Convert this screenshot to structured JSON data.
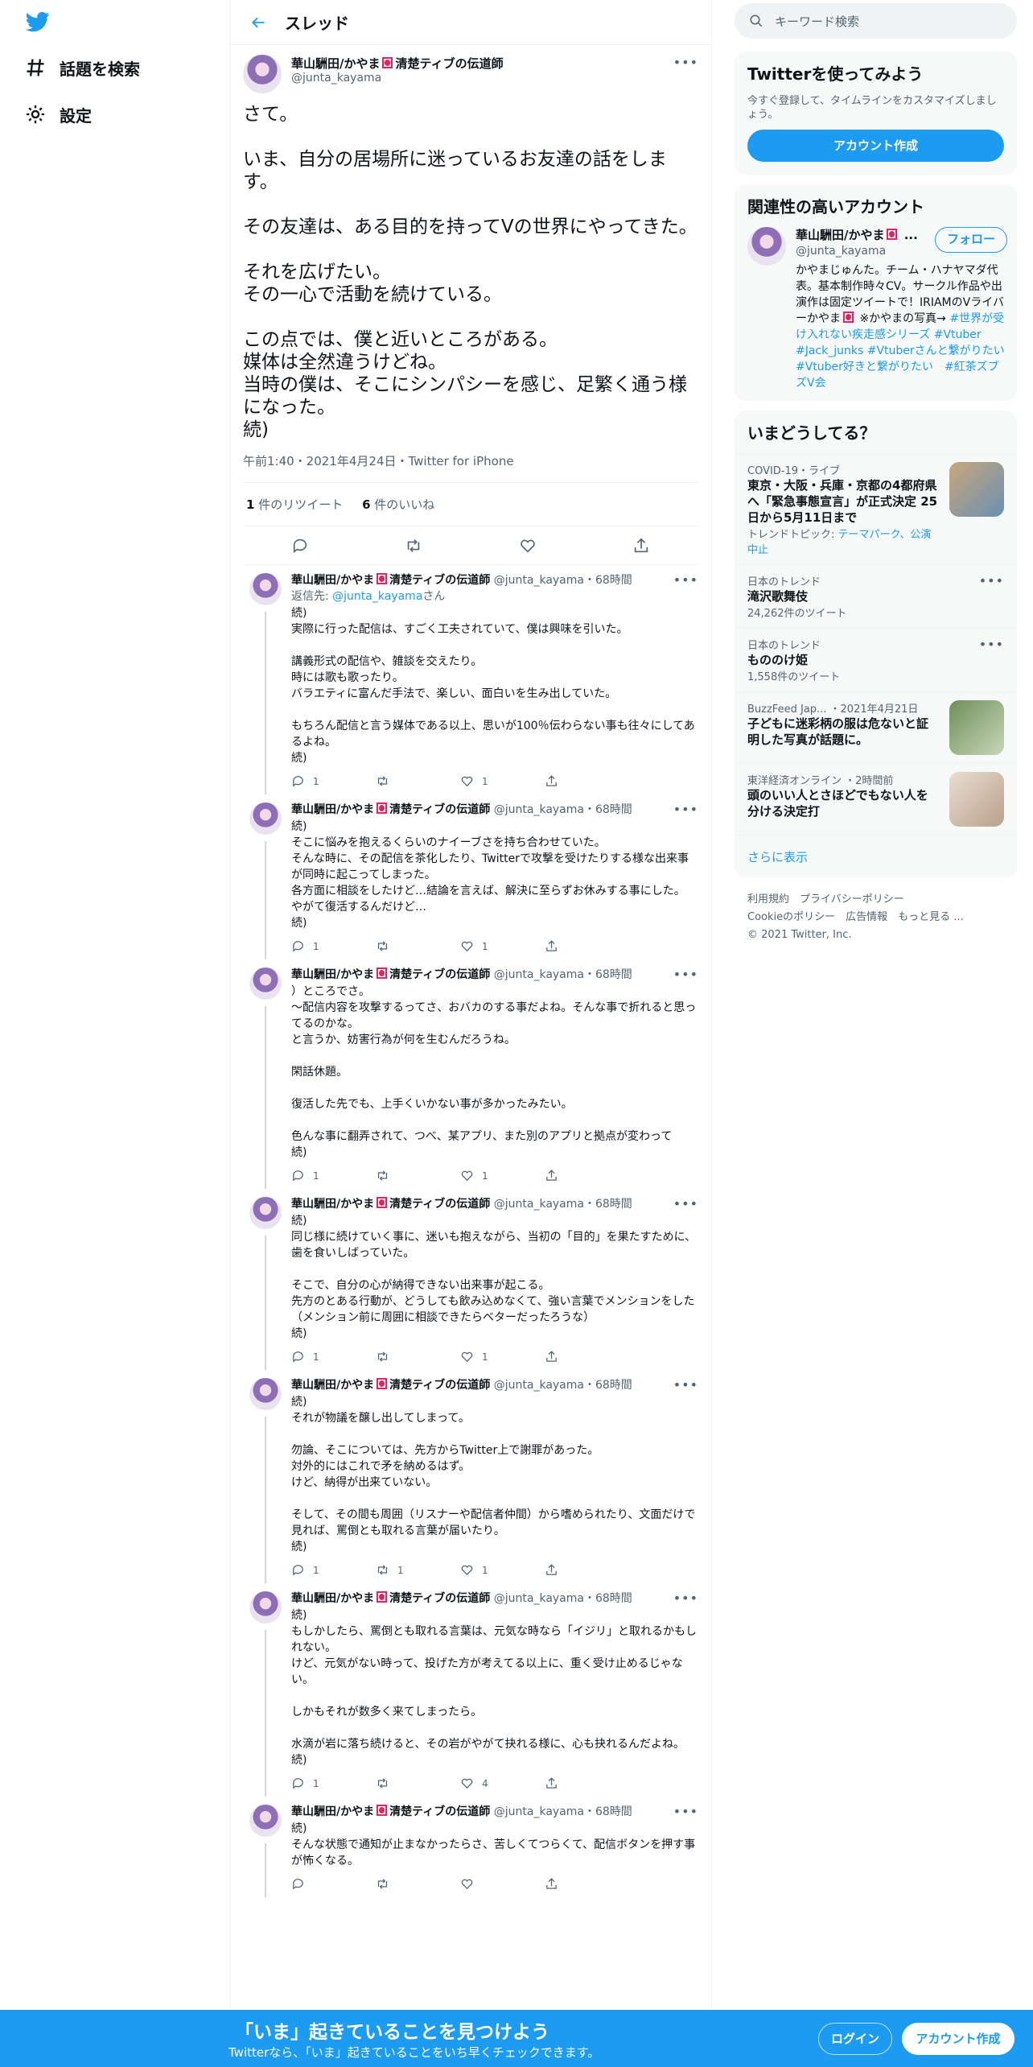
{
  "nav": {
    "explore": "話題を検索",
    "settings": "設定"
  },
  "header": {
    "title": "スレッド"
  },
  "author": {
    "name": "華山駲田/かやま",
    "name_suffix": "清楚ティブの伝道師",
    "handle": "@junta_kayama",
    "time": "68時間"
  },
  "main": {
    "text": "さて。\n\nいま、自分の居場所に迷っているお友達の話をします。\n\nその友達は、ある目的を持ってVの世界にやってきた。\n\nそれを広げたい。\nその一心で活動を続けている。\n\nこの点では、僕と近いところがある。\n媒体は全然違うけどね。\n当時の僕は、そこにシンパシーを感じ、足繁く通う様になった。\n続)",
    "meta": "午前1:40・2021年4月24日・Twitter for iPhone",
    "retweets": "1",
    "retweets_label": "件のリツイート",
    "likes": "6",
    "likes_label": "件のいいね"
  },
  "replies": [
    {
      "reply_to_prefix": "返信先: ",
      "reply_to": "@junta_kayama",
      "reply_to_suffix": "さん",
      "text": "続)\n実際に行った配信は、すごく工夫されていて、僕は興味を引いた。\n\n講義形式の配信や、雑談を交えたり。\n時には歌も歌ったり。\nバラエティに富んだ手法で、楽しい、面白いを生み出していた。\n\nもちろん配信と言う媒体である以上、思いが100％伝わらない事も往々にしてあるよね。\n続)",
      "replies": "1",
      "rts": "",
      "likes": "1"
    },
    {
      "reply_to_prefix": "",
      "reply_to": "",
      "reply_to_suffix": "",
      "text": "続)\nそこに悩みを抱えるくらいのナイーブさを持ち合わせていた。\nそんな時に、その配信を茶化したり、Twitterで攻撃を受けたりする様な出来事が同時に起こってしまった。\n各方面に相談をしたけど…結論を言えば、解決に至らずお休みする事にした。\nやがて復活するんだけど…\n続)",
      "replies": "1",
      "rts": "",
      "likes": "1"
    },
    {
      "reply_to_prefix": "",
      "reply_to": "",
      "reply_to_suffix": "",
      "text": "）ところでさ。\n〜配信内容を攻撃するってさ、おバカのする事だよね。そんな事で折れると思ってるのかな。\nと言うか、妨害行為が何を生むんだろうね。\n\n閑話休題。\n\n復活した先でも、上手くいかない事が多かったみたい。\n\n色んな事に翻弄されて、つべ、某アプリ、また別のアプリと拠点が変わって\n続)",
      "replies": "1",
      "rts": "",
      "likes": "1"
    },
    {
      "reply_to_prefix": "",
      "reply_to": "",
      "reply_to_suffix": "",
      "text": "続)\n同じ様に続けていく事に、迷いも抱えながら、当初の「目的」を果たすために、歯を食いしばっていた。\n\nそこで、自分の心が納得できない出来事が起こる。\n先方のとある行動が、どうしても飲み込めなくて、強い言葉でメンションをした（メンション前に周囲に相談できたらベターだったろうな）\n続)",
      "replies": "1",
      "rts": "",
      "likes": "1"
    },
    {
      "reply_to_prefix": "",
      "reply_to": "",
      "reply_to_suffix": "",
      "text": "続)\nそれが物議を醸し出してしまって。\n\n勿論、そこについては、先方からTwitter上で謝罪があった。\n対外的にはこれで矛を納めるはず。\nけど、納得が出来ていない。\n\nそして、その間も周囲（リスナーや配信者仲間）から嗜められたり、文面だけで見れば、罵倒とも取れる言葉が届いたり。\n続)",
      "replies": "1",
      "rts": "1",
      "likes": "1"
    },
    {
      "reply_to_prefix": "",
      "reply_to": "",
      "reply_to_suffix": "",
      "text": "続)\nもしかしたら、罵倒とも取れる言葉は、元気な時なら「イジリ」と取れるかもしれない。\nけど、元気がない時って、投げた方が考えてる以上に、重く受け止めるじゃない。\n\nしかもそれが数多く来てしまったら。\n\n水滴が岩に落ち続けると、その岩がやがて抉れる様に、心も抉れるんだよね。\n続)",
      "replies": "1",
      "rts": "",
      "likes": "4"
    },
    {
      "reply_to_prefix": "",
      "reply_to": "",
      "reply_to_suffix": "",
      "text": "続)\nそんな状態で通知が止まなかったらさ、苦しくてつらくて、配信ボタンを押す事が怖くなる。",
      "replies": "",
      "rts": "",
      "likes": ""
    }
  ],
  "search": {
    "placeholder": "キーワード検索"
  },
  "signup": {
    "title": "Twitterを使ってみよう",
    "desc": "今すぐ登録して、タイムラインをカスタマイズしましょう。",
    "button": "アカウント作成"
  },
  "related": {
    "title": "関連性の高いアカウント",
    "name": "華山駲田/かやま",
    "handle": "@junta_kayama",
    "follow": "フォロー",
    "bio": "かやまじゅんた。チーム・ハナヤマダ代表。基本制作時々CV。サークル作品や出演作は固定ツイートで！IRIAMのVライバーかやま",
    "bio2": " ※かやまの写真→ ",
    "tags": "#世界が受け入れない疾走感シリーズ #Vtuber #Jack_junks #Vtuberさんと繋がりたい #Vtuber好きと繋がりたい　#紅茶ズブズV会"
  },
  "trends": {
    "title": "いまどうしてる？",
    "items": [
      {
        "meta": "COVID-19・ライブ",
        "title": "東京・大阪・兵庫・京都の4都府県へ「緊急事態宣言」が正式決定 25日から5月11日まで",
        "sub_prefix": "トレンドトピック: ",
        "sub_link": "テーマパーク、公演中止",
        "count": ""
      },
      {
        "meta": "日本のトレンド",
        "title": "滝沢歌舞伎",
        "sub_prefix": "",
        "sub_link": "",
        "count": "24,262件のツイート"
      },
      {
        "meta": "日本のトレンド",
        "title": "もののけ姫",
        "sub_prefix": "",
        "sub_link": "",
        "count": "1,558件のツイート"
      },
      {
        "meta": "BuzzFeed Jap... ・2021年4月21日",
        "title": "子どもに迷彩柄の服は危ないと証明した写真が話題に。",
        "sub_prefix": "",
        "sub_link": "",
        "count": ""
      },
      {
        "meta": "東洋経済オンライン ・2時間前",
        "title": "頭のいい人とさほどでもない人を分ける決定打",
        "sub_prefix": "",
        "sub_link": "",
        "count": ""
      }
    ],
    "show_more": "さらに表示"
  },
  "footer": {
    "l1": "利用規約　プライバシーポリシー",
    "l2": "Cookieのポリシー　広告情報　もっと見る ...",
    "copy": "© 2021 Twitter, Inc."
  },
  "bottom": {
    "title": "「いま」起きていることを見つけよう",
    "sub": "Twitterなら、「いま」起きていることをいち早くチェックできます。",
    "login": "ログイン",
    "signup": "アカウント作成"
  },
  "colors": {
    "accent": "#1d9bf0",
    "text": "#0f1419",
    "muted": "#536471"
  }
}
